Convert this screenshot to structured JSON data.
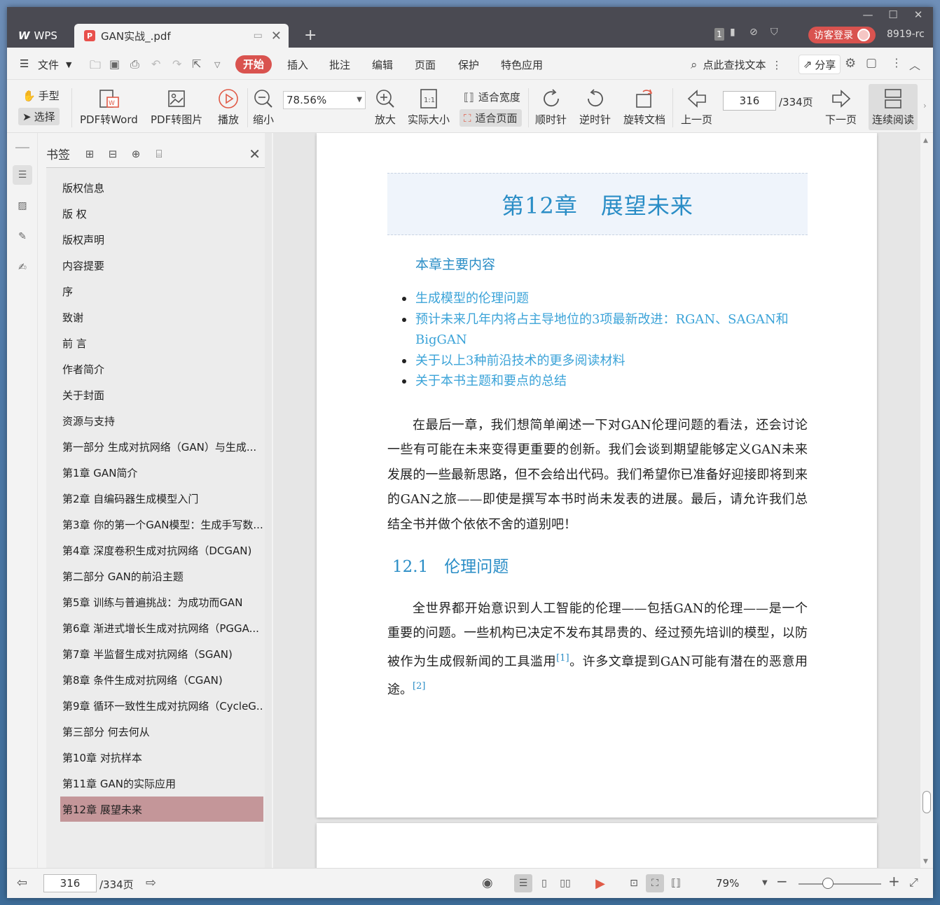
{
  "window": {
    "minimize": "—",
    "maximize": "☐",
    "close": "✕"
  },
  "tabs": {
    "home_label": "WPS",
    "doc_title": "GAN实战_.pdf",
    "add": "+"
  },
  "titlebar": {
    "badge": "1",
    "login": "访客登录",
    "user_id": "8919-rc"
  },
  "menu": {
    "file": "文件",
    "items": [
      "开始",
      "插入",
      "批注",
      "编辑",
      "页面",
      "保护",
      "特色应用"
    ],
    "search": "点此查找文本",
    "share": "分享"
  },
  "toolbar": {
    "hand": "手型",
    "select": "选择",
    "pdf_to_word": "PDF转Word",
    "pdf_to_image": "PDF转图片",
    "play": "播放",
    "zoom_out": "缩小",
    "zoom_value": "78.56%",
    "zoom_in": "放大",
    "actual_size": "实际大小",
    "fit_width": "适合宽度",
    "fit_page": "适合页面",
    "clockwise": "顺时针",
    "counter_clockwise": "逆时针",
    "rotate_doc": "旋转文档",
    "prev_page": "上一页",
    "current_page": "316",
    "total_pages": "/334页",
    "next_page": "下一页",
    "continuous": "连续阅读"
  },
  "bookmarks": {
    "title": "书签",
    "items": [
      {
        "label": "版权信息",
        "expandable": false
      },
      {
        "label": "版 权",
        "expandable": false
      },
      {
        "label": "版权声明",
        "expandable": false
      },
      {
        "label": "内容提要",
        "expandable": false
      },
      {
        "label": "序",
        "expandable": false
      },
      {
        "label": "致谢",
        "expandable": false
      },
      {
        "label": "前 言",
        "expandable": false
      },
      {
        "label": "作者简介",
        "expandable": false
      },
      {
        "label": "关于封面",
        "expandable": false
      },
      {
        "label": "资源与支持",
        "expandable": false
      },
      {
        "label": "第一部分 生成对抗网络（GAN）与生成...",
        "expandable": false
      },
      {
        "label": "第1章 GAN简介",
        "expandable": true
      },
      {
        "label": "第2章 自编码器生成模型入门",
        "expandable": true
      },
      {
        "label": "第3章 你的第一个GAN模型：生成手写数...",
        "expandable": true
      },
      {
        "label": "第4章 深度卷积生成对抗网络（DCGAN)",
        "expandable": true
      },
      {
        "label": "第二部分 GAN的前沿主题",
        "expandable": false
      },
      {
        "label": "第5章 训练与普遍挑战：为成功而GAN",
        "expandable": true
      },
      {
        "label": "第6章 渐进式增长生成对抗网络（PGGA...",
        "expandable": true
      },
      {
        "label": "第7章 半监督生成对抗网络（SGAN)",
        "expandable": true
      },
      {
        "label": "第8章 条件生成对抗网络（CGAN)",
        "expandable": true
      },
      {
        "label": "第9章 循环一致性生成对抗网络（CycleG...",
        "expandable": true
      },
      {
        "label": "第三部分 何去何从",
        "expandable": false
      },
      {
        "label": "第10章 对抗样本",
        "expandable": true
      },
      {
        "label": "第11章 GAN的实际应用",
        "expandable": true
      },
      {
        "label": "第12章 展望未来",
        "expandable": true,
        "selected": true
      }
    ]
  },
  "document": {
    "chapter_title": "第12章　展望未来",
    "summary_heading": "本章主要内容",
    "bullets": [
      "生成模型的伦理问题",
      "预计未来几年内将占主导地位的3项最新改进：RGAN、SAGAN和BigGAN",
      "关于以上3种前沿技术的更多阅读材料",
      "关于本书主题和要点的总结"
    ],
    "intro_paragraph": "在最后一章，我们想简单阐述一下对GAN伦理问题的看法，还会讨论一些有可能在未来变得更重要的创新。我们会谈到期望能够定义GAN未来发展的一些最新思路，但不会给出代码。我们希望你已准备好迎接即将到来的GAN之旅——即使是撰写本书时尚未发表的进展。最后，请允许我们总结全书并做个依依不舍的道别吧！",
    "section_heading": "12.1　伦理问题",
    "section_para_part1": "全世界都开始意识到人工智能的伦理——包括GAN的伦理——是一个重要的问题。一些机构已决定不发布其昂贵的、经过预先培训的模型，以防被作为生成假新闻的工具滥用",
    "ref1": "[1]",
    "section_para_part2": "。许多文章提到GAN可能有潜在的恶意用途。",
    "ref2": "[2]"
  },
  "statusbar": {
    "current_page": "316",
    "total_pages": "/334页",
    "zoom": "79%"
  }
}
